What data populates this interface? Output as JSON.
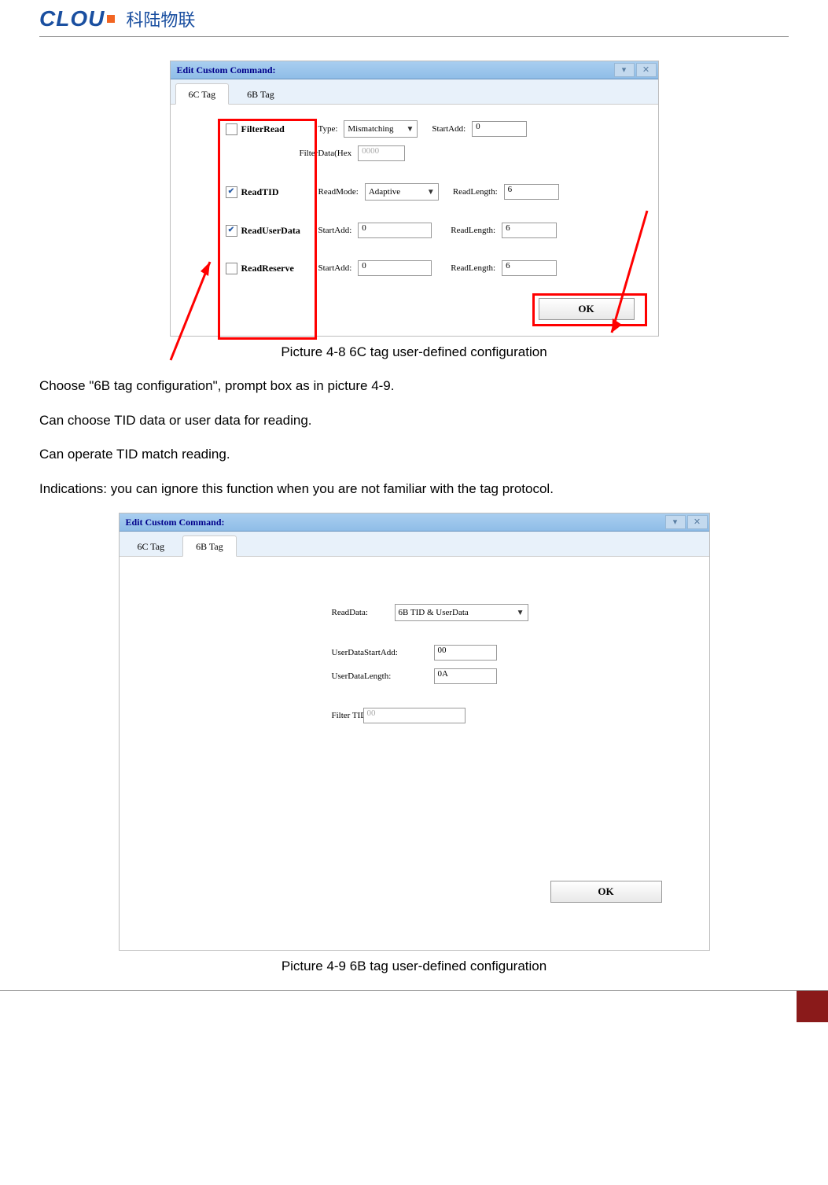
{
  "header": {
    "logo_text": "CLOU",
    "logo_cn": "科陆物联"
  },
  "dialog1": {
    "title": "Edit Custom Command:",
    "tabs": {
      "tab_6c": "6C Tag",
      "tab_6b": "6B Tag"
    },
    "filterRead": {
      "label": "FilterRead",
      "type_lbl": "Type:",
      "type_val": "Mismatching",
      "start_lbl": "StartAdd:",
      "start_val": "0",
      "hex_lbl": "FilterData(Hex",
      "hex_val": "0000"
    },
    "readTID": {
      "label": "ReadTID",
      "mode_lbl": "ReadMode:",
      "mode_val": "Adaptive",
      "len_lbl": "ReadLength:",
      "len_val": "6"
    },
    "readUser": {
      "label": "ReadUserData",
      "start_lbl": "StartAdd:",
      "start_val": "0",
      "len_lbl": "ReadLength:",
      "len_val": "6"
    },
    "readReserve": {
      "label": "ReadReserve",
      "start_lbl": "StartAdd:",
      "start_val": "0",
      "len_lbl": "ReadLength:",
      "len_val": "6"
    },
    "ok": "OK"
  },
  "caption1": "Picture 4-8    6C tag user-defined configuration",
  "para1": "Choose \"6B tag configuration\", prompt box as in picture 4-9.",
  "para2": "Can choose TID data or user data for reading.",
  "para3": "Can operate TID match reading.",
  "para4": "Indications: you can ignore this function when you are not familiar with the tag protocol.",
  "dialog2": {
    "title": "Edit Custom Command:",
    "tabs": {
      "tab_6c": "6C Tag",
      "tab_6b": "6B Tag"
    },
    "readData_lbl": "ReadData:",
    "readData_val": "6B TID & UserData",
    "userStart_lbl": "UserDataStartAdd:",
    "userStart_val": "00",
    "userLen_lbl": "UserDataLength:",
    "userLen_val": "0A",
    "filterTid_lbl": "Filter TID:",
    "filterTid_val": "00",
    "ok": "OK"
  },
  "caption2": "Picture 4-9    6B tag user-defined configuration"
}
